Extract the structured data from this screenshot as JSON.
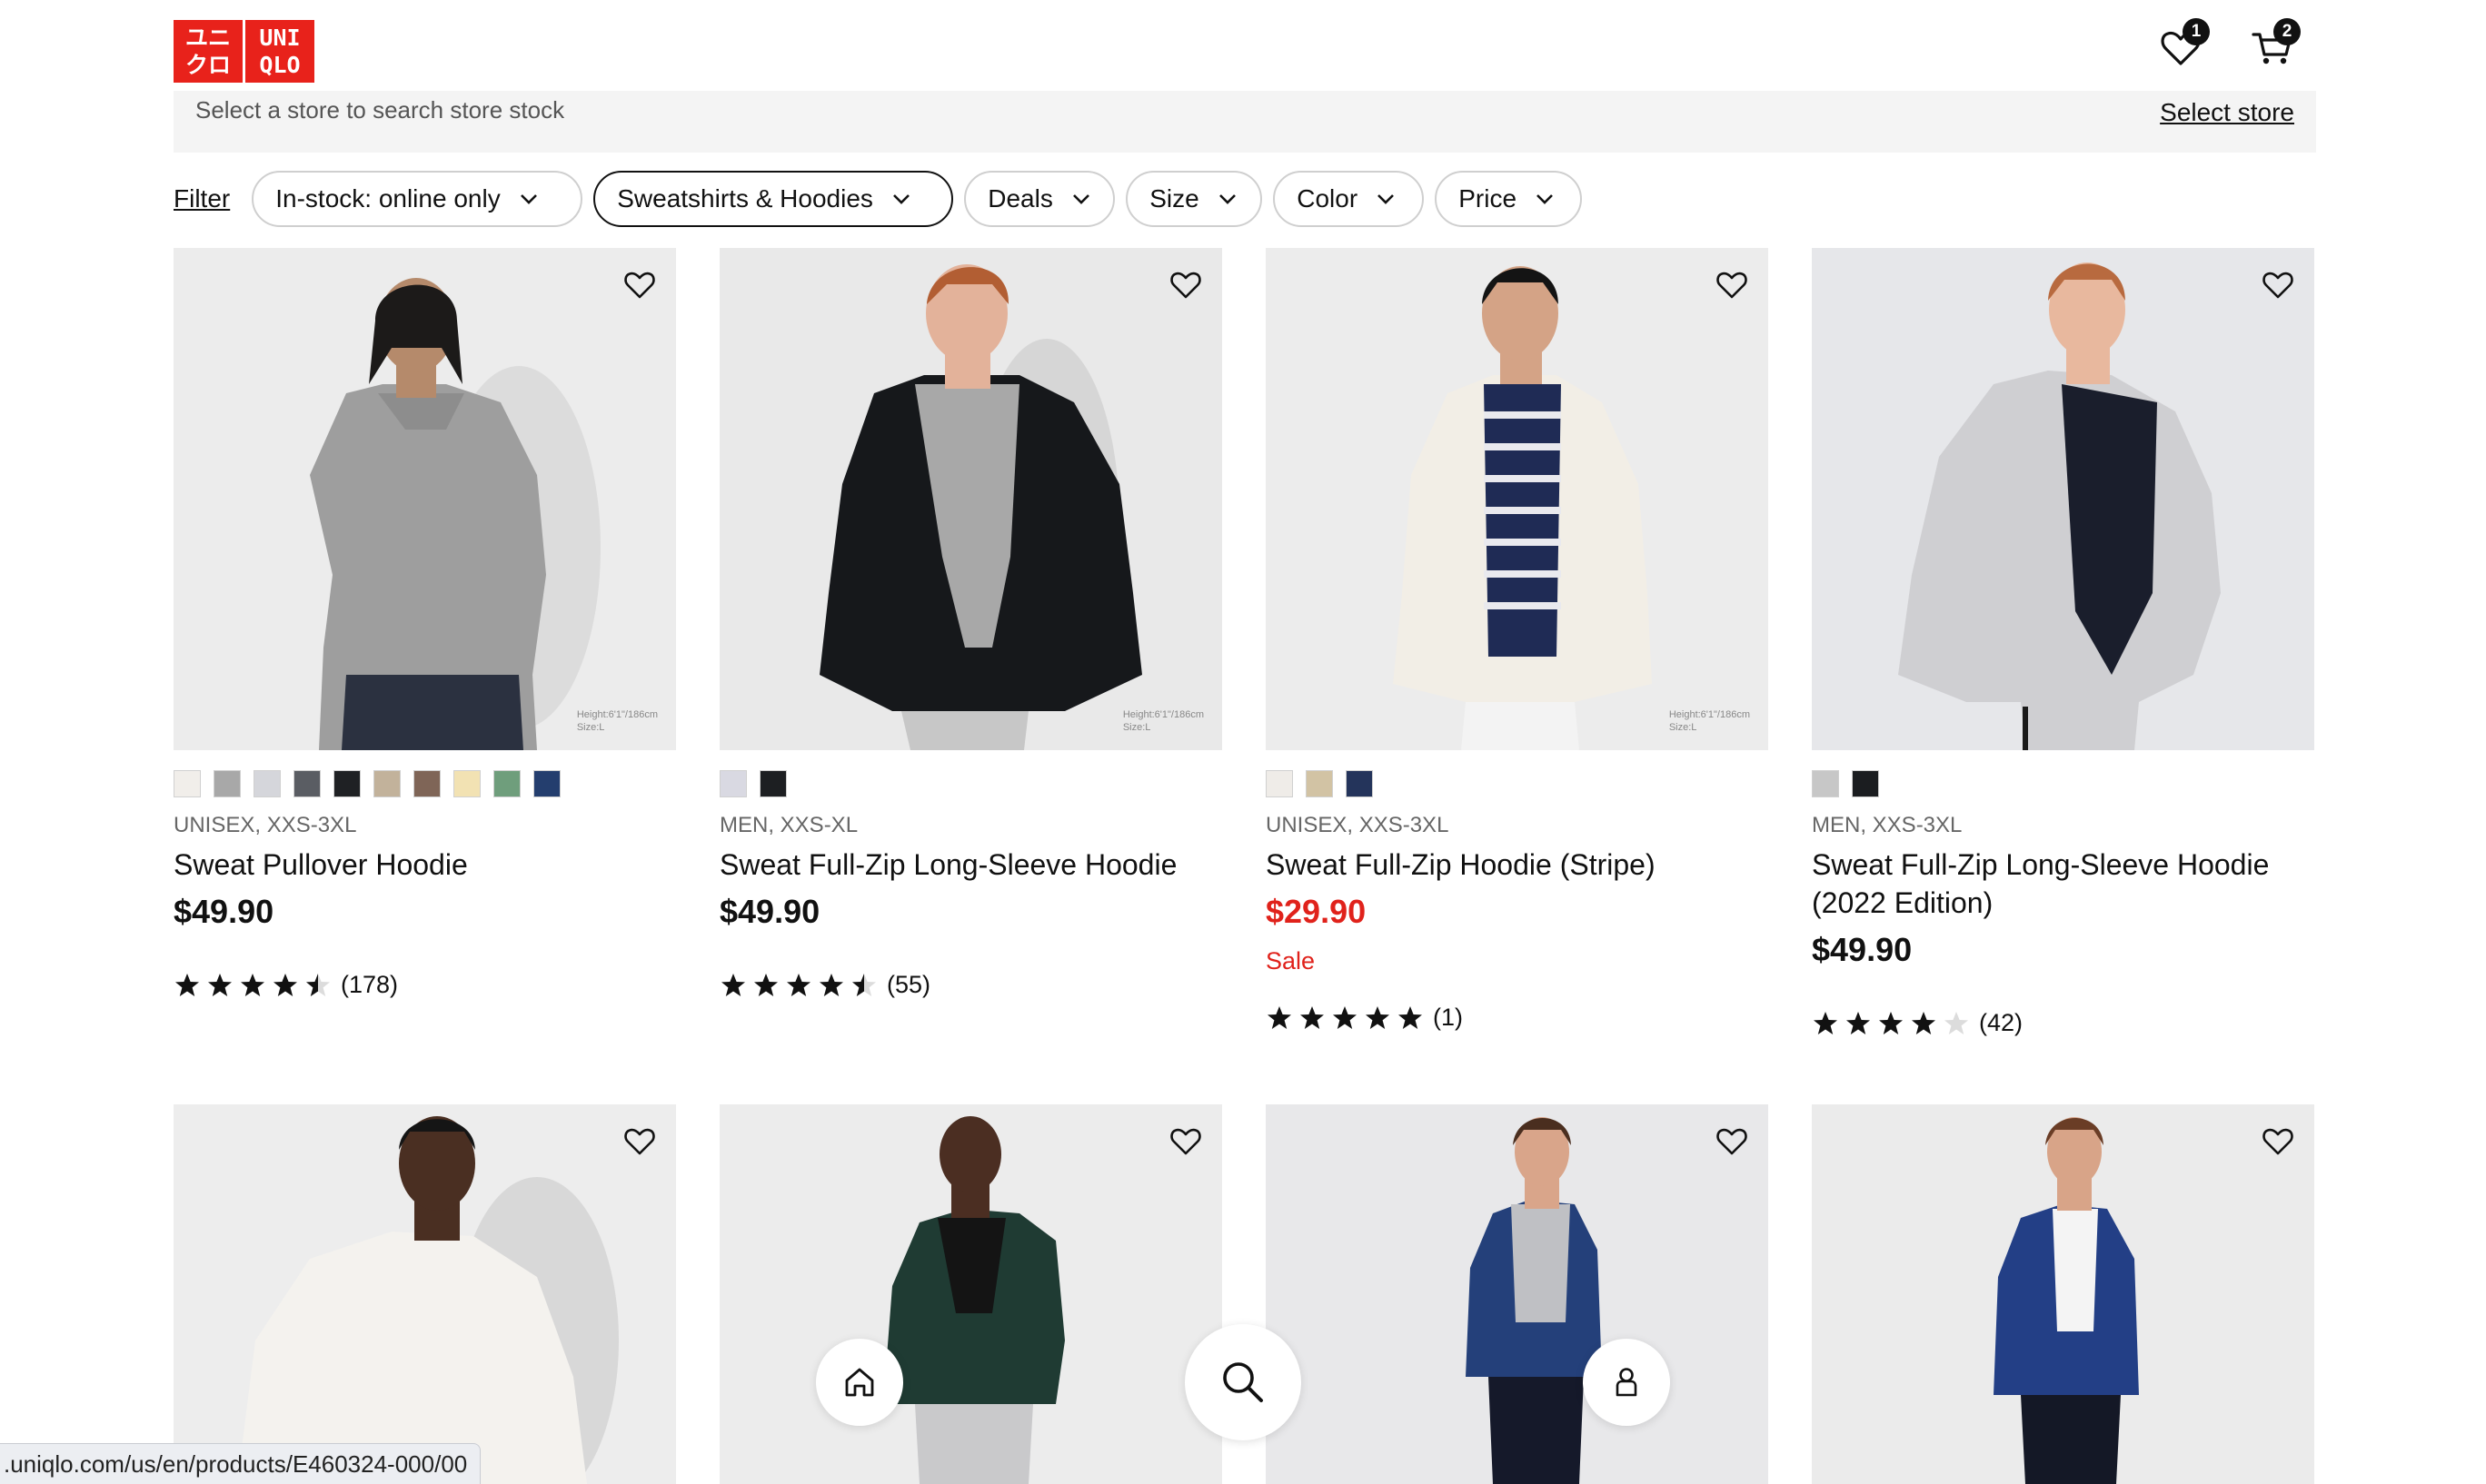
{
  "header": {
    "logo_top": "ユニ",
    "logo_top_right": "UNI",
    "logo_bottom": "クロ",
    "logo_bottom_right": "QLO",
    "wishlist_count": "1",
    "cart_count": "2",
    "logo_icon": "uniqlo-logo",
    "wishlist_icon": "heart-icon",
    "cart_icon": "cart-icon"
  },
  "store": {
    "prompt": "Select a store to search store stock",
    "link": "Select store"
  },
  "filters": {
    "filter_label": "Filter",
    "chips": [
      {
        "label": "In-stock: online only"
      },
      {
        "label": "Sweatshirts & Hoodies"
      },
      {
        "label": "Deals"
      },
      {
        "label": "Size"
      },
      {
        "label": "Color"
      },
      {
        "label": "Price"
      }
    ]
  },
  "products": [
    {
      "meta": "UNISEX, XXS-3XL",
      "name": "Sweat Pullover Hoodie",
      "price": "$49.90",
      "rating": 4.5,
      "reviews": "(178)",
      "measure_1": "Height:6'1\"/186cm",
      "measure_2": "Size:L",
      "swatches": [
        "#f1eeea",
        "#a8a8a8",
        "#d5d6db",
        "#5a5d63",
        "#1f2124",
        "#c2b29b",
        "#7f6557",
        "#f2e2b3",
        "#6f9e7c",
        "#243e6e"
      ]
    },
    {
      "meta": "MEN, XXS-XL",
      "name": "Sweat Full-Zip Long-Sleeve Hoodie",
      "price": "$49.90",
      "rating": 4.5,
      "reviews": "(55)",
      "measure_1": "Height:6'1\"/186cm",
      "measure_2": "Size:L",
      "swatches": [
        "#d9d9e2",
        "#1d1f22"
      ]
    },
    {
      "meta": "UNISEX, XXS-3XL",
      "name": "Sweat Full-Zip Hoodie (Stripe)",
      "price": "$29.90",
      "sale": "Sale",
      "rating": 5,
      "reviews": "(1)",
      "measure_1": "Height:6'1\"/186cm",
      "measure_2": "Size:L",
      "swatches": [
        "#efece8",
        "#d2c3a4",
        "#24345b"
      ]
    },
    {
      "meta": "MEN, XXS-3XL",
      "name": "Sweat Full-Zip Long-Sleeve Hoodie (2022 Edition)",
      "price": "$49.90",
      "rating": 4,
      "reviews": "(42)",
      "swatches": [
        "#c7c7c7",
        "#1b1d20"
      ]
    }
  ],
  "bottom_nav": {
    "home_icon": "home-icon",
    "search_icon": "search-icon",
    "account_icon": "user-icon"
  },
  "status_url": ".uniqlo.com/us/en/products/E460324-000/00",
  "colors": {
    "brand": "#e8221b",
    "sale": "#e0221b"
  }
}
